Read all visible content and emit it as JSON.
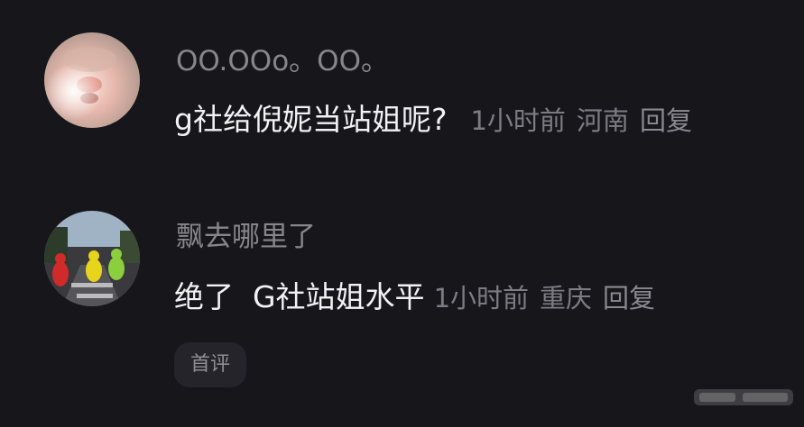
{
  "comments": [
    {
      "username": "OO.OOo。OO。",
      "text": "g社给倪妮当站姐呢?",
      "time": "1小时前",
      "location": "河南",
      "reply": "回复",
      "avatar_icon": "hamster-photo-avatar"
    },
    {
      "username": "飘去哪里了",
      "text": "绝了  G社站姐水平",
      "time": "1小时前",
      "location": "重庆",
      "reply": "回复",
      "avatar_icon": "teletubbies-photo-avatar"
    }
  ],
  "badge": {
    "label": "首评"
  },
  "colors": {
    "background": "#17161b",
    "username": "#87868b",
    "text": "#f2f2f4",
    "meta": "#7d7c82",
    "badge_bg": "#25242a"
  }
}
